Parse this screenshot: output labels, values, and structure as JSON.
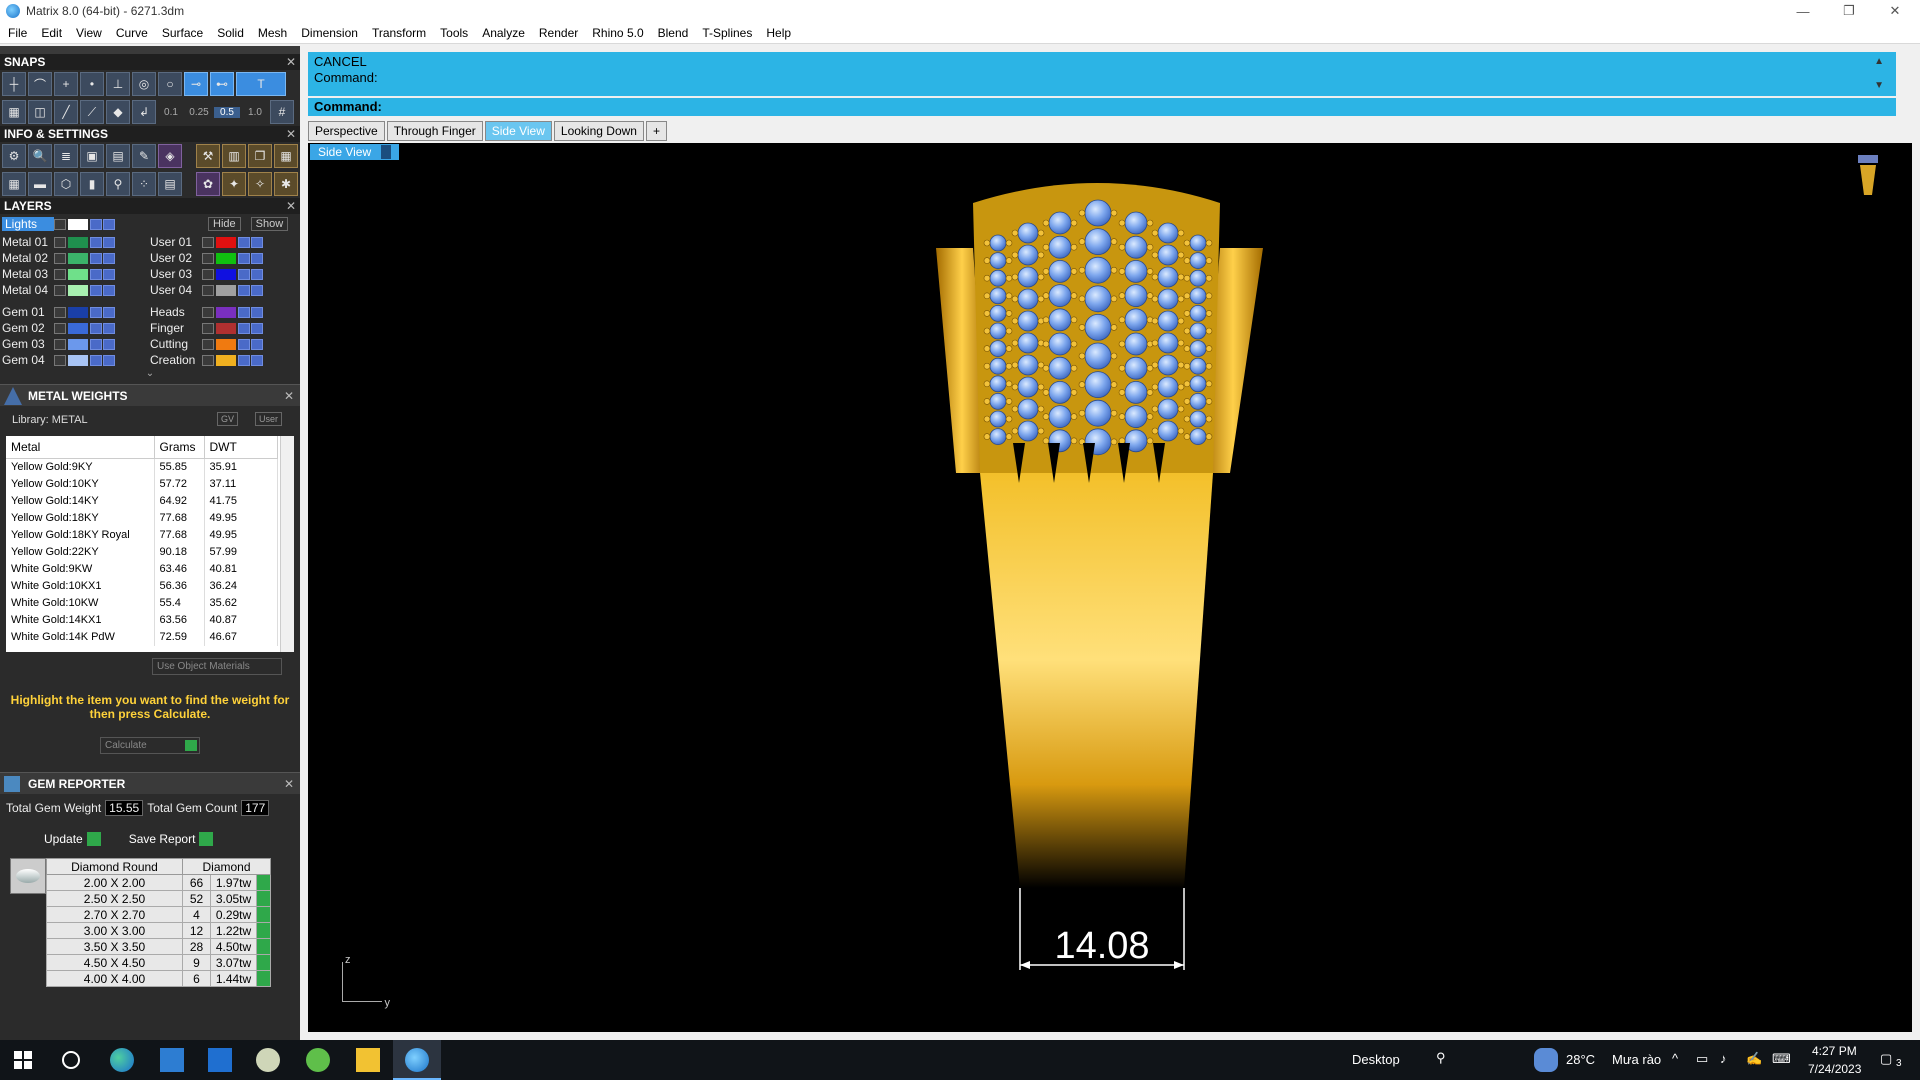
{
  "window": {
    "title": "Matrix 8.0 (64-bit) - 6271.3dm",
    "min": "—",
    "restore": "❐",
    "close": "✕"
  },
  "menu": [
    "File",
    "Edit",
    "View",
    "Curve",
    "Surface",
    "Solid",
    "Mesh",
    "Dimension",
    "Transform",
    "Tools",
    "Analyze",
    "Render",
    "Rhino 5.0",
    "Blend",
    "T-Splines",
    "Help"
  ],
  "snaps": {
    "title": "SNAPS",
    "nums": [
      "0.1",
      "0.25",
      "0.5",
      "1.0"
    ]
  },
  "info": {
    "title": "INFO & SETTINGS"
  },
  "layers": {
    "title": "LAYERS",
    "lights": "Lights",
    "hide": "Hide",
    "show": "Show",
    "left": [
      {
        "name": "Metal 01",
        "color": "#1f8f4e"
      },
      {
        "name": "Metal 02",
        "color": "#3bb36a"
      },
      {
        "name": "Metal 03",
        "color": "#6fe08a"
      },
      {
        "name": "Metal 04",
        "color": "#a8f0b0"
      },
      {
        "name": "Gem 01",
        "color": "#1a3fa8"
      },
      {
        "name": "Gem 02",
        "color": "#3a6ad8"
      },
      {
        "name": "Gem 03",
        "color": "#6b98ec"
      },
      {
        "name": "Gem 04",
        "color": "#a8c4f4"
      }
    ],
    "right": [
      {
        "name": "User 01",
        "color": "#e01010"
      },
      {
        "name": "User 02",
        "color": "#10c010"
      },
      {
        "name": "User 03",
        "color": "#1010e0"
      },
      {
        "name": "User 04",
        "color": "#a0a0a0"
      },
      {
        "name": "Heads",
        "color": "#7a2fbf"
      },
      {
        "name": "Finger",
        "color": "#b03030"
      },
      {
        "name": "Cutting",
        "color": "#f07a10"
      },
      {
        "name": "Creation",
        "color": "#f0b020"
      }
    ]
  },
  "metal_weights": {
    "title": "METAL WEIGHTS",
    "library": "Library: METAL",
    "gv": "GV",
    "user": "User",
    "headers": [
      "Metal",
      "Grams",
      "DWT"
    ],
    "rows": [
      [
        "Yellow Gold:9KY",
        "55.85",
        "35.91"
      ],
      [
        "Yellow Gold:10KY",
        "57.72",
        "37.11"
      ],
      [
        "Yellow Gold:14KY",
        "64.92",
        "41.75"
      ],
      [
        "Yellow Gold:18KY",
        "77.68",
        "49.95"
      ],
      [
        "Yellow Gold:18KY Royal",
        "77.68",
        "49.95"
      ],
      [
        "Yellow Gold:22KY",
        "90.18",
        "57.99"
      ],
      [
        "White Gold:9KW",
        "63.46",
        "40.81"
      ],
      [
        "White Gold:10KX1",
        "56.36",
        "36.24"
      ],
      [
        "White Gold:10KW",
        "55.4",
        "35.62"
      ],
      [
        "White Gold:14KX1",
        "63.56",
        "40.87"
      ],
      [
        "White Gold:14K PdW",
        "72.59",
        "46.67"
      ]
    ],
    "use_object": "Use Object Materials",
    "hint": "Highlight the item you want to find the weight for then press Calculate.",
    "calculate": "Calculate"
  },
  "gem_reporter": {
    "title": "GEM REPORTER",
    "total_weight_label": "Total Gem Weight",
    "total_weight": "15.55",
    "total_count_label": "Total Gem Count",
    "total_count": "177",
    "update": "Update",
    "save": "Save Report",
    "headers": [
      "Diamond Round",
      "Diamond"
    ],
    "rows": [
      [
        "2.00 X 2.00",
        "66",
        "1.97tw"
      ],
      [
        "2.50 X 2.50",
        "52",
        "3.05tw"
      ],
      [
        "2.70 X 2.70",
        "4",
        "0.29tw"
      ],
      [
        "3.00 X 3.00",
        "12",
        "1.22tw"
      ],
      [
        "3.50 X 3.50",
        "28",
        "4.50tw"
      ],
      [
        "4.50 X 4.50",
        "9",
        "3.07tw"
      ],
      [
        "4.00 X 4.00",
        "6",
        "1.44tw"
      ]
    ]
  },
  "command": {
    "line1": "CANCEL",
    "line2": "Command:",
    "prompt": "Command:"
  },
  "tabs": [
    "Perspective",
    "Through Finger",
    "Side View",
    "Looking Down",
    "+"
  ],
  "active_tab": "Side View",
  "viewport": {
    "label": "Side View",
    "dimension": "14.08",
    "axis_z": "z",
    "axis_y": "y"
  },
  "taskbar": {
    "desktop": "Desktop",
    "temp": "28°C",
    "weather": "Mưa rào",
    "time": "4:27 PM",
    "date": "7/24/2023",
    "notif": "3"
  }
}
